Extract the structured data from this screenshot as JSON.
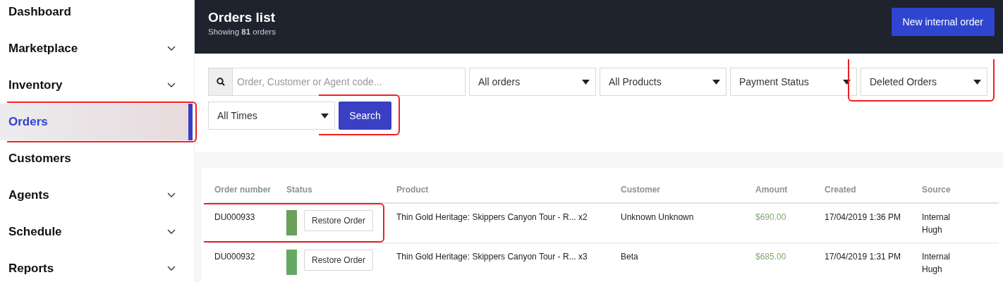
{
  "sidebar": {
    "items": [
      {
        "label": "Dashboard",
        "expandable": false,
        "selected": false
      },
      {
        "label": "Marketplace",
        "expandable": true,
        "selected": false
      },
      {
        "label": "Inventory",
        "expandable": true,
        "selected": false
      },
      {
        "label": "Orders",
        "expandable": false,
        "selected": true
      },
      {
        "label": "Customers",
        "expandable": false,
        "selected": false
      },
      {
        "label": "Agents",
        "expandable": true,
        "selected": false
      },
      {
        "label": "Schedule",
        "expandable": true,
        "selected": false
      },
      {
        "label": "Reports",
        "expandable": true,
        "selected": false
      }
    ]
  },
  "header": {
    "title": "Orders list",
    "subtitle": "Showing **81** orders",
    "button": "New internal order"
  },
  "filters": {
    "search": {
      "placeholder": "Order, Customer or Agent code..."
    },
    "dropdowns": [
      {
        "value": "All orders"
      },
      {
        "value": "All Products"
      },
      {
        "value": "Payment Status"
      },
      {
        "value": "Deleted Orders"
      },
      {
        "value": "All Times"
      }
    ],
    "search_button": "Search"
  },
  "table": {
    "columns": [
      "Order number",
      "Status",
      "Product",
      "Customer",
      "Amount",
      "Created",
      "Source"
    ],
    "rows": [
      {
        "order_number": "DU000933",
        "color": "#6a9f5c",
        "action": "Restore Order",
        "product": "Thin Gold Heritage: Skippers Canyon Tour - R... x2",
        "customer": "Unknown Unknown",
        "amount": "$690.00",
        "created": "17/04/2019 1:36 PM",
        "source": "Internal\nHugh"
      },
      {
        "order_number": "DU000932",
        "color": "#66a862",
        "action": "Restore Order",
        "product": "Thin Gold Heritage: Skippers Canyon Tour - R... x3",
        "customer": "Beta",
        "amount": "$685.00",
        "created": "17/04/2019 1:31 PM",
        "source": "Internal\nHugh"
      }
    ]
  }
}
